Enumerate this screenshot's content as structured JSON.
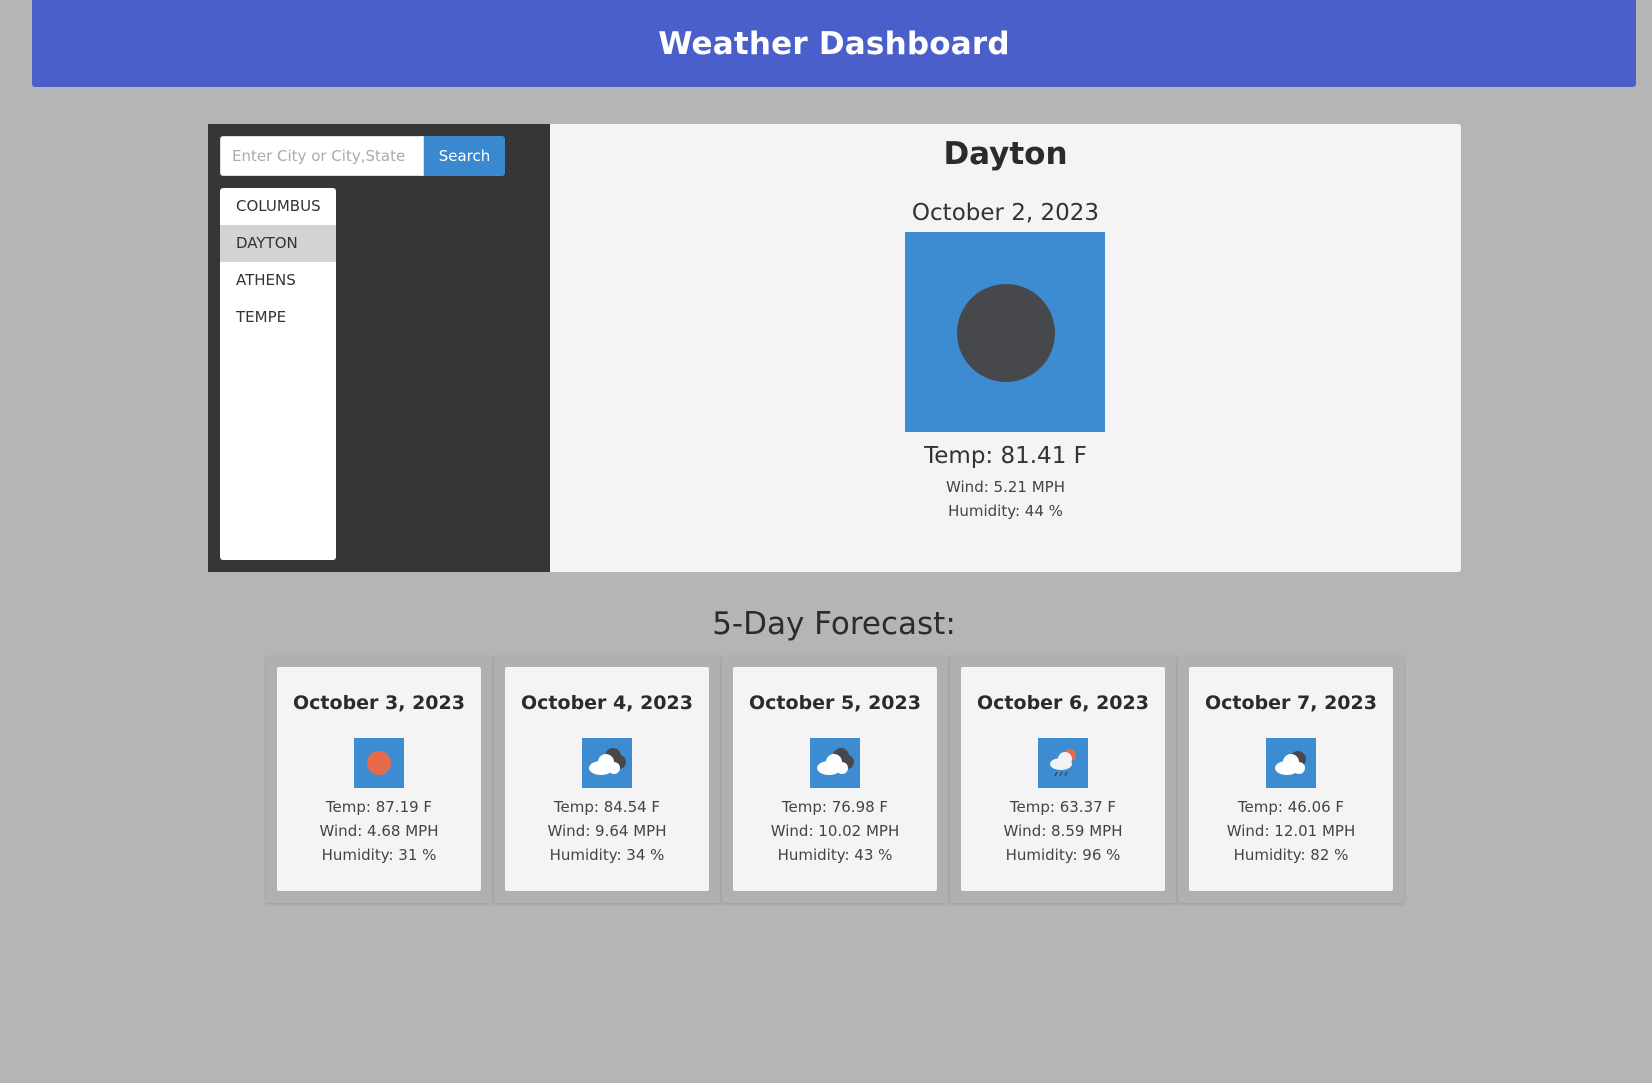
{
  "header": {
    "title": "Weather Dashboard"
  },
  "search": {
    "placeholder": "Enter City or City,State",
    "button_label": "Search"
  },
  "history": {
    "items": [
      {
        "label": "COLUMBUS"
      },
      {
        "label": "DAYTON",
        "active": true
      },
      {
        "label": "ATHENS"
      },
      {
        "label": "TEMPE"
      }
    ]
  },
  "current": {
    "city": "Dayton",
    "date": "October 2, 2023",
    "icon": "moon-icon",
    "temp": "Temp: 81.41 F",
    "wind": "Wind: 5.21 MPH",
    "humidity": "Humidity: 44 %"
  },
  "forecast": {
    "title": "5-Day Forecast:",
    "days": [
      {
        "date": "October 3, 2023",
        "icon": "sun-icon",
        "temp": "Temp: 87.19 F",
        "wind": "Wind: 4.68 MPH",
        "humidity": "Humidity: 31 %"
      },
      {
        "date": "October 4, 2023",
        "icon": "cloudy-night-icon",
        "temp": "Temp: 84.54 F",
        "wind": "Wind: 9.64 MPH",
        "humidity": "Humidity: 34 %"
      },
      {
        "date": "October 5, 2023",
        "icon": "cloudy-night-icon",
        "temp": "Temp: 76.98 F",
        "wind": "Wind: 10.02 MPH",
        "humidity": "Humidity: 43 %"
      },
      {
        "date": "October 6, 2023",
        "icon": "rain-icon",
        "temp": "Temp: 63.37 F",
        "wind": "Wind: 8.59 MPH",
        "humidity": "Humidity: 96 %"
      },
      {
        "date": "October 7, 2023",
        "icon": "partly-cloudy-night-icon",
        "temp": "Temp: 46.06 F",
        "wind": "Wind: 12.01 MPH",
        "humidity": "Humidity: 82 %"
      }
    ]
  },
  "colors": {
    "header_bg": "#4a5fc9",
    "page_bg": "#b5b5b5",
    "sidebar_bg": "#363636",
    "button_bg": "#3a88d0",
    "icon_bg": "#3d8cd1",
    "panel_bg": "#f4f4f4"
  }
}
